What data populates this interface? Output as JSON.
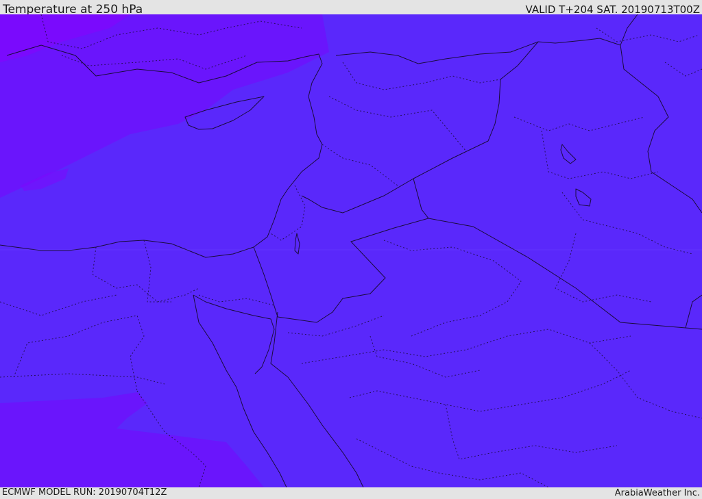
{
  "header": {
    "title": "Temperature at 250 hPa",
    "valid": "VALID T+204 SAT. 20190713T00Z"
  },
  "footer": {
    "model_run": "ECMWF MODEL RUN: 20190704T12Z",
    "credit": "ArabiaWeather Inc."
  },
  "colors": {
    "field_base": "#5a28fb",
    "field_warm": "#6a15fc",
    "field_warmer": "#7a0afd",
    "border": "#1a0b3c",
    "chrome": "#e4e4e4"
  }
}
